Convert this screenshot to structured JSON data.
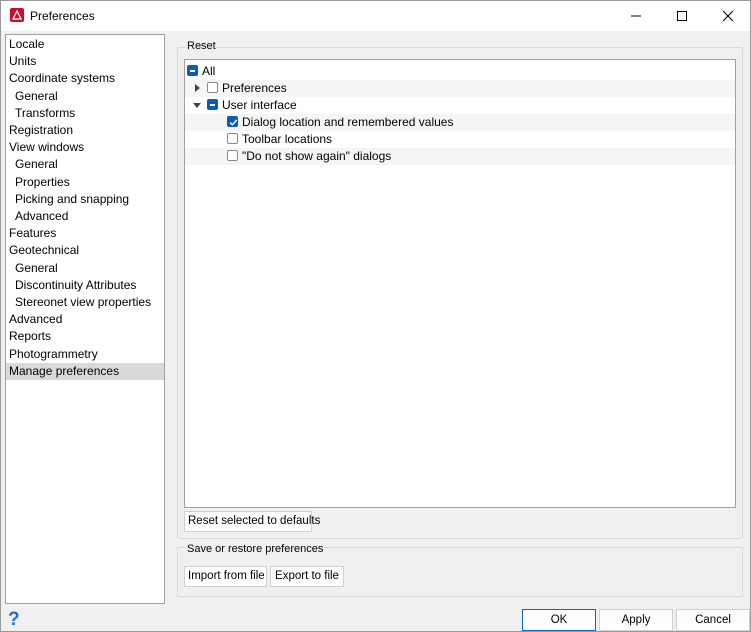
{
  "window": {
    "title": "Preferences",
    "app_icon": "app-logo-icon"
  },
  "nav": {
    "items": [
      {
        "label": "Locale",
        "level": 0
      },
      {
        "label": "Units",
        "level": 0
      },
      {
        "label": "Coordinate systems",
        "level": 0
      },
      {
        "label": "General",
        "level": 1
      },
      {
        "label": "Transforms",
        "level": 1
      },
      {
        "label": "Registration",
        "level": 0
      },
      {
        "label": "View windows",
        "level": 0
      },
      {
        "label": "General",
        "level": 1
      },
      {
        "label": "Properties",
        "level": 1
      },
      {
        "label": "Picking and snapping",
        "level": 1
      },
      {
        "label": "Advanced",
        "level": 1
      },
      {
        "label": "Features",
        "level": 0
      },
      {
        "label": "Geotechnical",
        "level": 0
      },
      {
        "label": "General",
        "level": 1
      },
      {
        "label": "Discontinuity Attributes",
        "level": 1
      },
      {
        "label": "Stereonet view properties",
        "level": 1
      },
      {
        "label": "Advanced",
        "level": 0
      },
      {
        "label": "Reports",
        "level": 0
      },
      {
        "label": "Photogrammetry",
        "level": 0
      },
      {
        "label": "Manage preferences",
        "level": 0,
        "selected": true
      }
    ]
  },
  "reset": {
    "title": "Reset",
    "tree": [
      {
        "label": "All",
        "state": "partial"
      },
      {
        "label": "Preferences",
        "state": "unchecked",
        "expander": "collapsed"
      },
      {
        "label": "User interface",
        "state": "partial",
        "expander": "expanded"
      },
      {
        "label": "Dialog location and remembered values",
        "state": "checked"
      },
      {
        "label": "Toolbar locations",
        "state": "unchecked"
      },
      {
        "label": "\"Do not show again\" dialogs",
        "state": "unchecked"
      }
    ],
    "reset_button": "Reset selected to defaults"
  },
  "save": {
    "title": "Save or restore preferences",
    "import_button": "Import from file",
    "export_button": "Export to file"
  },
  "footer": {
    "help_glyph": "?",
    "ok": "OK",
    "apply": "Apply",
    "cancel": "Cancel"
  },
  "colors": {
    "accent": "#0a5fb4",
    "selected_nav": "#d9d9d9",
    "help": "#1f6fc6"
  }
}
